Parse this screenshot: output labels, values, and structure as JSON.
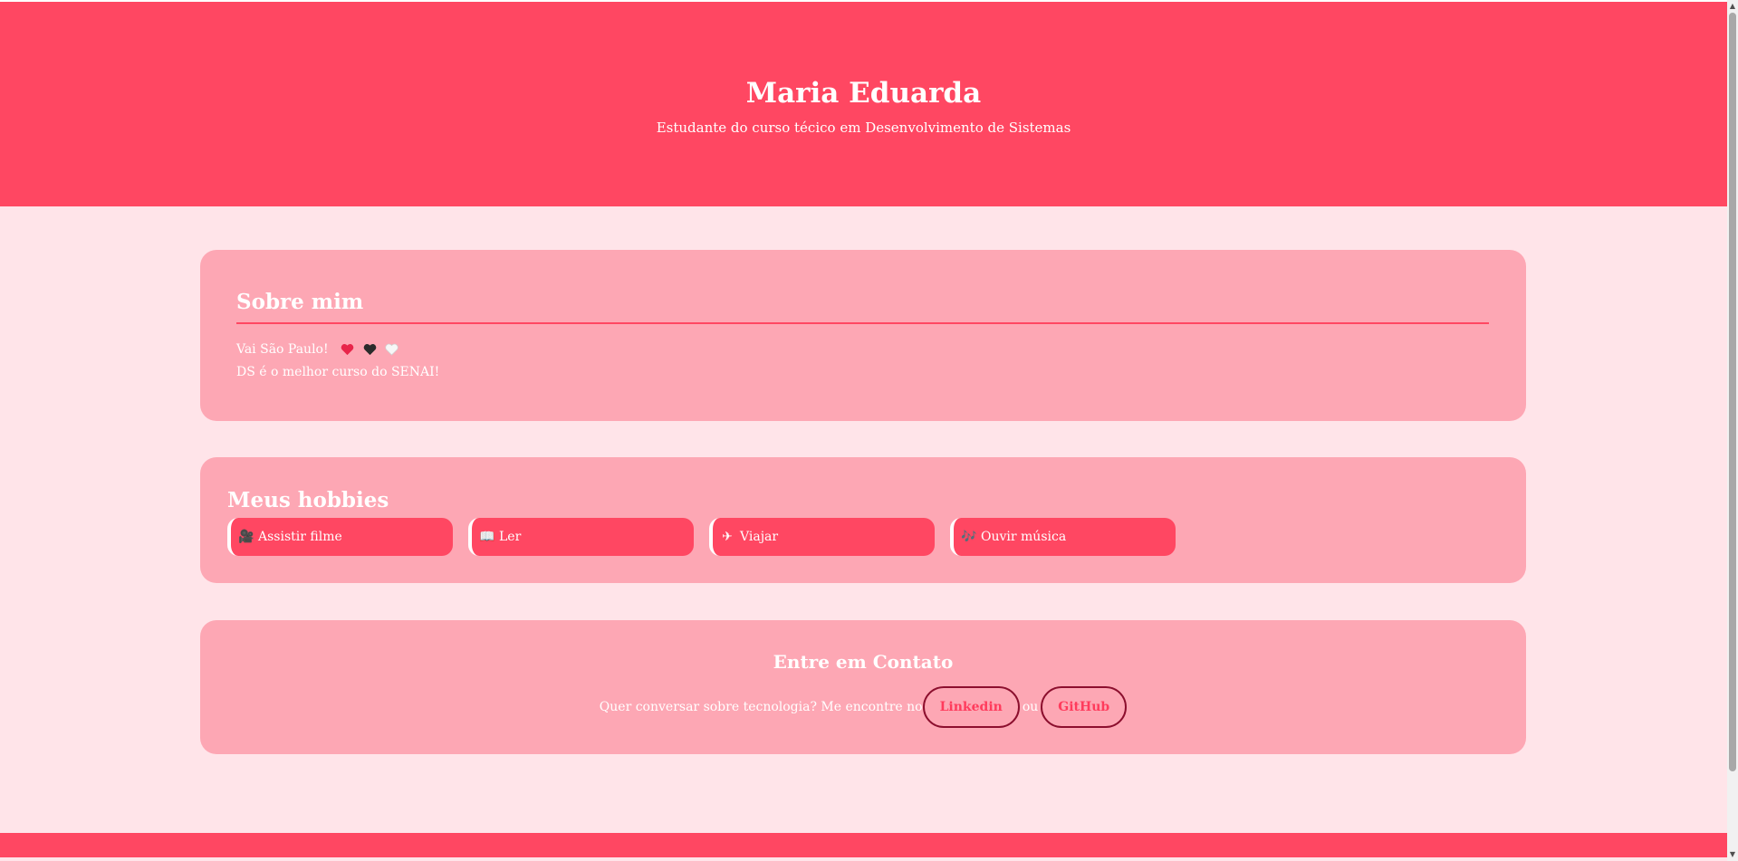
{
  "header": {
    "name": "Maria Eduarda",
    "subtitle": "Estudante do curso técico em Desenvolvimento de Sistemas"
  },
  "about": {
    "title": "Sobre mim",
    "line1": "Vai São Paulo!",
    "line2": "DS é o melhor curso do SENAI!",
    "hearts": [
      "red-heart",
      "black-heart",
      "white-heart"
    ]
  },
  "hobbies": {
    "title": "Meus hobbies",
    "items": [
      {
        "icon": "🎥",
        "label": "Assistir filme"
      },
      {
        "icon": "📖",
        "label": "Ler"
      },
      {
        "icon": "✈",
        "label": "Viajar"
      },
      {
        "icon": "🎶",
        "label": "Ouvir música"
      }
    ]
  },
  "contact": {
    "title": "Entre em Contato",
    "text": "Quer conversar sobre tecnologia? Me encontre no",
    "linkedin": "Linkedin",
    "or": "ou",
    "github": "GitHub"
  },
  "colors": {
    "primary": "#ff4762",
    "card": "#fda7b4",
    "background": "#ffe4e9",
    "pill_border": "#8c0f2e"
  },
  "scrollbar": {
    "up_icon": "▲",
    "down_icon": "▼"
  }
}
